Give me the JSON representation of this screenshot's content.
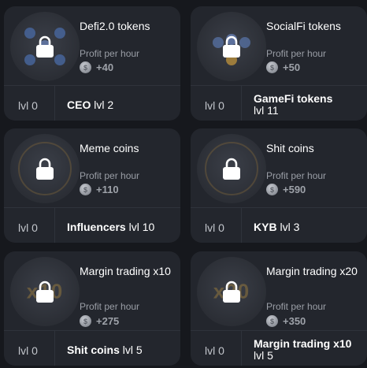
{
  "cards": [
    {
      "title": "Defi2.0 tokens",
      "profit_label": "Profit per hour",
      "profit": "+40",
      "level": "lvl 0",
      "requirement_bold": "CEO",
      "requirement_rest": " lvl 2",
      "icon": "lock-icon"
    },
    {
      "title": "SocialFi tokens",
      "profit_label": "Profit per hour",
      "profit": "+50",
      "level": "lvl 0",
      "requirement_bold": "GameFi tokens",
      "requirement_rest": " lvl 11",
      "icon": "lock-icon"
    },
    {
      "title": "Meme coins",
      "profit_label": "Profit per hour",
      "profit": "+110",
      "level": "lvl 0",
      "requirement_bold": "Influencers",
      "requirement_rest": " lvl 10",
      "icon": "lock-icon"
    },
    {
      "title": "Shit coins",
      "profit_label": "Profit per hour",
      "profit": "+590",
      "level": "lvl 0",
      "requirement_bold": "KYB",
      "requirement_rest": " lvl 3",
      "icon": "lock-icon"
    },
    {
      "title": "Margin trading x10",
      "profit_label": "Profit per hour",
      "profit": "+275",
      "level": "lvl 0",
      "requirement_bold": "Shit coins",
      "requirement_rest": " lvl 5",
      "icon": "lock-icon",
      "image_text": "x10"
    },
    {
      "title": "Margin trading x20",
      "profit_label": "Profit per hour",
      "profit": "+350",
      "level": "lvl 0",
      "requirement_bold": "Margin trading x10",
      "requirement_rest": " lvl 5",
      "icon": "lock-icon",
      "image_text": "x20"
    }
  ],
  "colors": {
    "background": "#16181d",
    "card": "#23262d",
    "muted": "#9a9ea6",
    "accent_gold": "#c99a3c"
  }
}
